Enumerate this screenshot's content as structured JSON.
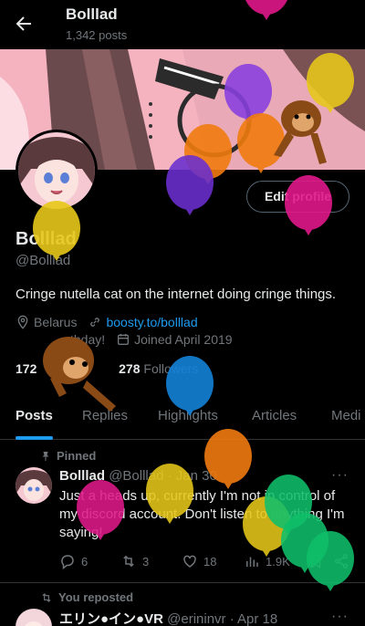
{
  "header": {
    "title": "Bolllad",
    "posts_count": "1,342 posts"
  },
  "profile": {
    "name": "Bolllad",
    "handle": "@Bolllad",
    "bio": "Cringe nutella cat on the internet doing cringe things.",
    "location": "Belarus",
    "link": "boosty.to/bolllad",
    "birthday": "thday!",
    "joined": "Joined April 2019",
    "edit_label": "Edit profile",
    "following_count": "172",
    "followers_count": "278",
    "followers_label": "Followers"
  },
  "tabs": [
    {
      "label": "Posts",
      "active": true
    },
    {
      "label": "Replies"
    },
    {
      "label": "Highlights"
    },
    {
      "label": "Articles"
    },
    {
      "label": "Medi"
    }
  ],
  "pinned_post": {
    "pinned_label": "Pinned",
    "author": "Bolllad",
    "handle_date": "@Bolllad · Jan 30",
    "text": "Just a heads up, currently I'm not in control of my discord account. Don't listen to anything I'm saying!",
    "replies": "6",
    "reposts": "3",
    "likes": "18",
    "views": "1.9K",
    "more": "···"
  },
  "second_post": {
    "repost_label": "You reposted",
    "author": "エリン●イン●VR",
    "handle_date": "@erininvr · Apr 18",
    "more": "···"
  },
  "colors": {
    "accent": "#1d9bf0",
    "muted": "#71767b",
    "divider": "#2f3336",
    "banner_bg": "#f4b3bf"
  }
}
